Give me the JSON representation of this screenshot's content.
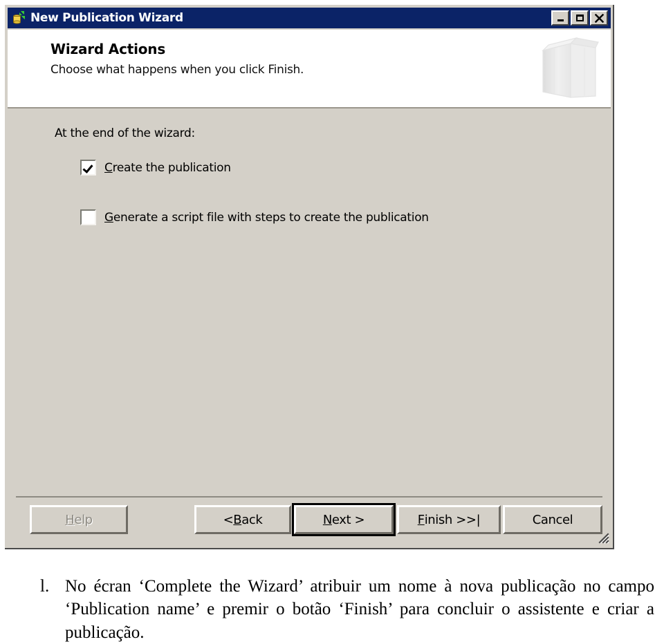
{
  "window": {
    "title": "New Publication Wizard",
    "icon": "publication-database-icon",
    "controls": [
      {
        "name": "minimize-button",
        "glyph": "_",
        "label": "Minimize"
      },
      {
        "name": "maximize-button",
        "glyph": "□",
        "label": "Maximize"
      },
      {
        "name": "close-button",
        "glyph": "✕",
        "label": "Close"
      }
    ],
    "colors": {
      "titlebar": "#0b2367",
      "face": "#d4d0c8",
      "header": "#ffffff"
    }
  },
  "header": {
    "title": "Wizard Actions",
    "subtitle": "Choose what happens when you click Finish.",
    "graphic": "publication-book-icon"
  },
  "content": {
    "prompt": "At the end of the wizard:",
    "options": [
      {
        "name": "create-the-publication",
        "mnemonic": "C",
        "rest": "reate the publication",
        "checked": true
      },
      {
        "name": "generate-a-script-file",
        "mnemonic": "G",
        "rest": "enerate a script file with steps to create the publication",
        "checked": false
      }
    ]
  },
  "footer": {
    "buttons": [
      {
        "name": "help-button",
        "pre": "",
        "mnemonic": "H",
        "post": "elp",
        "state": "disabled"
      },
      {
        "name": "back-button",
        "pre": "< ",
        "mnemonic": "B",
        "post": "ack",
        "state": "enabled"
      },
      {
        "name": "next-button",
        "pre": "",
        "mnemonic": "N",
        "post": "ext >",
        "state": "default"
      },
      {
        "name": "finish-button",
        "pre": "",
        "mnemonic": "F",
        "post": "inish >>|",
        "state": "enabled"
      },
      {
        "name": "cancel-button",
        "pre": "",
        "mnemonic": "",
        "post": "Cancel",
        "state": "enabled"
      }
    ]
  },
  "caption": {
    "marker": "l.",
    "text": "No écran ‘Complete the Wizard’ atribuir um nome à nova publicação no campo ‘Publication name’ e premir o botão ‘Finish’ para concluir o assistente e criar a publicação."
  }
}
